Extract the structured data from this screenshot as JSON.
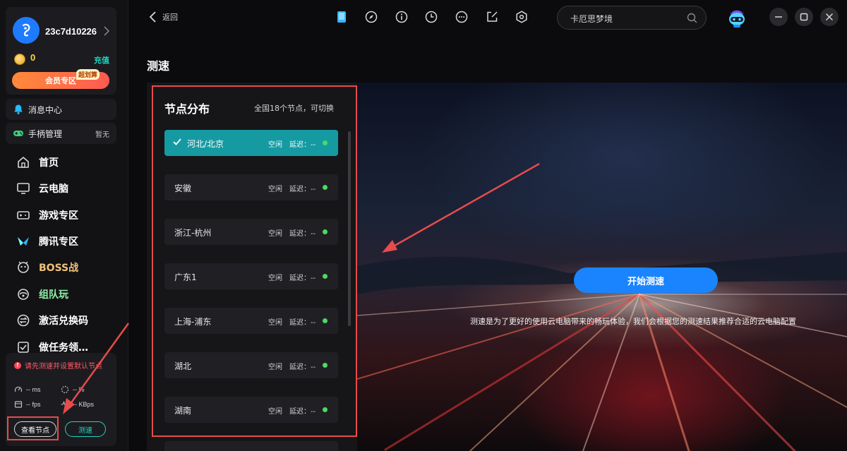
{
  "user": {
    "name": "23c7d10226",
    "coins": "0",
    "recharge_label": "充值",
    "vip_label": "会员专区",
    "vip_badge": "超划算"
  },
  "sidebar": {
    "messages_label": "消息中心",
    "gamepad_label": "手柄管理",
    "gamepad_status": "暂无",
    "items": [
      {
        "label": "首页",
        "icon": "home-icon"
      },
      {
        "label": "云电脑",
        "icon": "monitor-icon"
      },
      {
        "label": "游戏专区",
        "icon": "gamepad-icon"
      },
      {
        "label": "腾讯专区",
        "icon": "tencent-icon"
      },
      {
        "label": "BOSS战",
        "icon": "boss-icon"
      },
      {
        "label": "组队玩",
        "icon": "team-icon"
      },
      {
        "label": "激活兑换码",
        "icon": "exchange-icon"
      },
      {
        "label": "做任务领…",
        "icon": "task-icon"
      }
    ]
  },
  "status": {
    "warning": "请先测速并设置默认节点",
    "ms": "-- ms",
    "loss": "-- %",
    "fps": "-- fps",
    "kbps": "-- KBps",
    "view_nodes_label": "查看节点",
    "speedtest_label": "测速"
  },
  "topbar": {
    "back_label": "返回",
    "search_value": "卡厄思梦境"
  },
  "page": {
    "title": "测速"
  },
  "nodes": {
    "title": "节点分布",
    "subtitle": "全国18个节点，可切换",
    "list": [
      {
        "name": "河北/北京",
        "state": "空闲",
        "latency": "延迟：--"
      },
      {
        "name": "安徽",
        "state": "空闲",
        "latency": "延迟：--"
      },
      {
        "name": "浙江-杭州",
        "state": "空闲",
        "latency": "延迟：--"
      },
      {
        "name": "广东1",
        "state": "空闲",
        "latency": "延迟：--"
      },
      {
        "name": "上海-浦东",
        "state": "空闲",
        "latency": "延迟：--"
      },
      {
        "name": "湖北",
        "state": "空闲",
        "latency": "延迟：--"
      },
      {
        "name": "湖南",
        "state": "空闲",
        "latency": "延迟：--"
      }
    ],
    "selected_index": 0
  },
  "speedtest": {
    "start_label": "开始测速",
    "description": "测速是为了更好的使用云电脑带来的畅玩体验，我们会根据您的测速结果推荐合适的云电脑配置"
  },
  "colors": {
    "accent": "#169aa2",
    "primary_button": "#1a84ff",
    "annotation_red": "#e84b4b",
    "online_dot": "#4cd964"
  }
}
